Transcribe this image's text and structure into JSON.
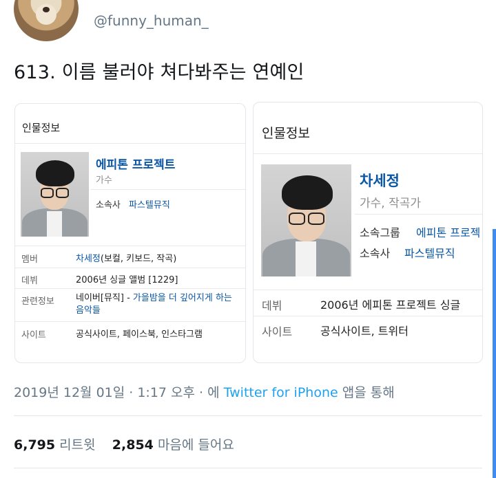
{
  "tweet": {
    "handle": "@funny_human_",
    "text": "613. 이름 불러야 쳐다봐주는 연예인"
  },
  "card1": {
    "header": "인물정보",
    "name": "에피톤 프로젝트",
    "role": "가수",
    "agency_label": "소속사",
    "agency_value": "파스텔뮤직",
    "rows": [
      {
        "label": "멤버",
        "value_link": "차세정",
        "value_text": "(보컬, 키보드, 작곡)"
      },
      {
        "label": "데뷔",
        "value_text": "2006년 싱글 앨범 [1229]"
      },
      {
        "label": "관련정보",
        "value_text": "네이버[뮤직] - ",
        "value_link": "가을밤을 더 깊어지게 하는 음악들"
      },
      {
        "label": "사이트",
        "value_link": "공식사이트, 페이스북, 인스타그램"
      }
    ]
  },
  "card2": {
    "header": "인물정보",
    "name": "차세정",
    "role": "가수, 작곡가",
    "group_label": "소속그룹",
    "group_value": "에피톤 프로젝",
    "agency_label": "소속사",
    "agency_value": "파스텔뮤직",
    "rows": [
      {
        "label": "데뷔",
        "value_text": "2006년 에피톤 프로젝트 싱글"
      },
      {
        "label": "사이트",
        "value_link": "공식사이트, 트위터"
      }
    ]
  },
  "meta": {
    "datetime": "2019년 12월 01일 · 1:17 오후 · 에",
    "source": "Twitter for iPhone",
    "suffix": "앱을 통해"
  },
  "stats": {
    "retweets": "6,795",
    "retweets_label": "리트윗",
    "likes": "2,854",
    "likes_label": "마음에 들어요"
  },
  "colors": {
    "link": "#0b57a6",
    "twitter_blue": "#1da1f2",
    "muted": "#657786"
  }
}
